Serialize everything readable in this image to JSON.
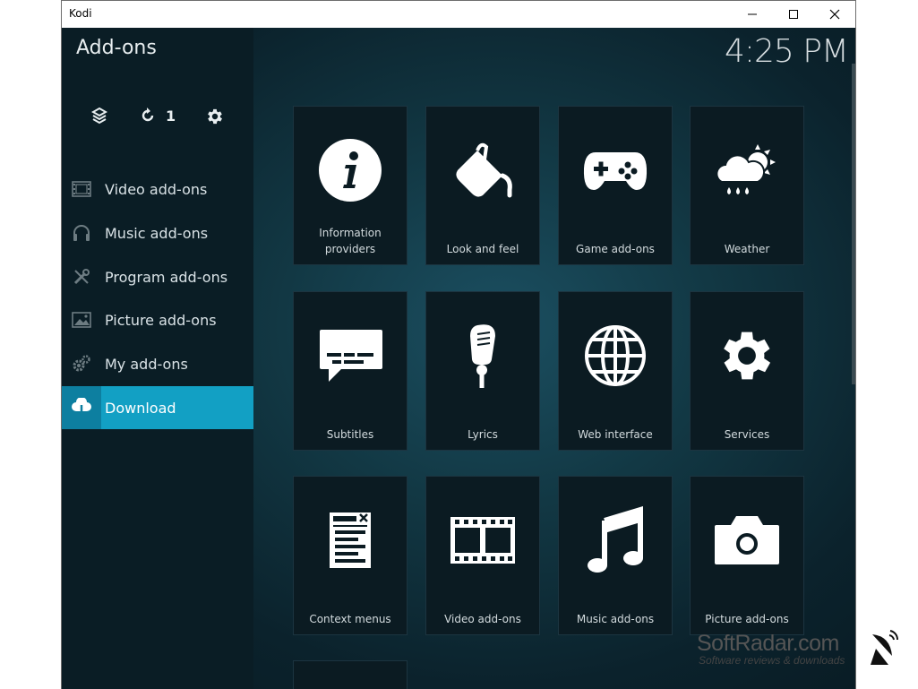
{
  "window": {
    "title": "Kodi",
    "minimize_icon": "minimize-icon",
    "maximize_icon": "maximize-icon",
    "close_icon": "close-icon"
  },
  "sidebar": {
    "heading": "Add-ons",
    "top_icons": [
      {
        "icon": "dropbox-icon"
      },
      {
        "icon": "refresh-icon",
        "count": "1"
      },
      {
        "icon": "gear-icon"
      }
    ],
    "items": [
      {
        "label": "Video add-ons",
        "icon": "film-icon"
      },
      {
        "label": "Music add-ons",
        "icon": "headphones-icon"
      },
      {
        "label": "Program add-ons",
        "icon": "tools-icon"
      },
      {
        "label": "Picture add-ons",
        "icon": "picture-icon"
      },
      {
        "label": "My add-ons",
        "icon": "gears-icon"
      },
      {
        "label": "Download",
        "icon": "cloud-download-icon",
        "active": true
      }
    ]
  },
  "clock": "4:25 PM",
  "tiles": [
    {
      "label": "Information providers",
      "icon": "info-icon"
    },
    {
      "label": "Look and feel",
      "icon": "paint-bucket-icon"
    },
    {
      "label": "Game add-ons",
      "icon": "gamepad-icon"
    },
    {
      "label": "Weather",
      "icon": "weather-icon"
    },
    {
      "label": "Subtitles",
      "icon": "subtitles-icon"
    },
    {
      "label": "Lyrics",
      "icon": "microphone-icon"
    },
    {
      "label": "Web interface",
      "icon": "globe-icon"
    },
    {
      "label": "Services",
      "icon": "gear-icon"
    },
    {
      "label": "Context menus",
      "icon": "context-menu-icon"
    },
    {
      "label": "Video add-ons",
      "icon": "film-icon"
    },
    {
      "label": "Music add-ons",
      "icon": "music-note-icon"
    },
    {
      "label": "Picture add-ons",
      "icon": "camera-icon"
    }
  ],
  "watermark": {
    "brand": "SoftRadar.com",
    "tagline": "Software reviews & downloads"
  },
  "colors": {
    "accent": "#12a0c4",
    "sidebar_bg": "#0a1d25",
    "tile_bg": "#0b1b22"
  }
}
